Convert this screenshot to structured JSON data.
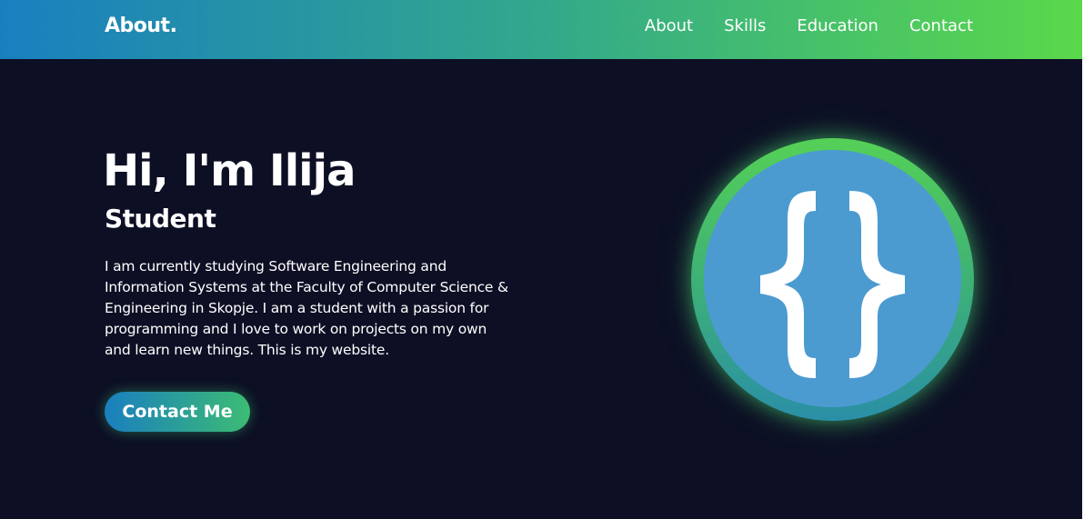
{
  "nav": {
    "brand": "About.",
    "links": [
      "About",
      "Skills",
      "Education",
      "Contact"
    ]
  },
  "hero": {
    "title": "Hi, I'm Ilija",
    "subtitle": "Student",
    "description": "I am currently studying Software Engineering and Information Systems at the Faculty of Computer Science & Engineering in Skopje. I am a student with a passion for programming and I love to work on projects on my own and learn new things. This is my website.",
    "cta_label": "Contact Me"
  },
  "avatar": {
    "icon": "curly-braces-icon"
  },
  "colors": {
    "background": "#0d0f24",
    "nav_gradient_start": "#1a7fbf",
    "nav_gradient_end": "#5ad84a",
    "avatar_fill": "#4b9bd1",
    "ring_top": "#55d056",
    "ring_bottom": "#2a8fa7"
  }
}
